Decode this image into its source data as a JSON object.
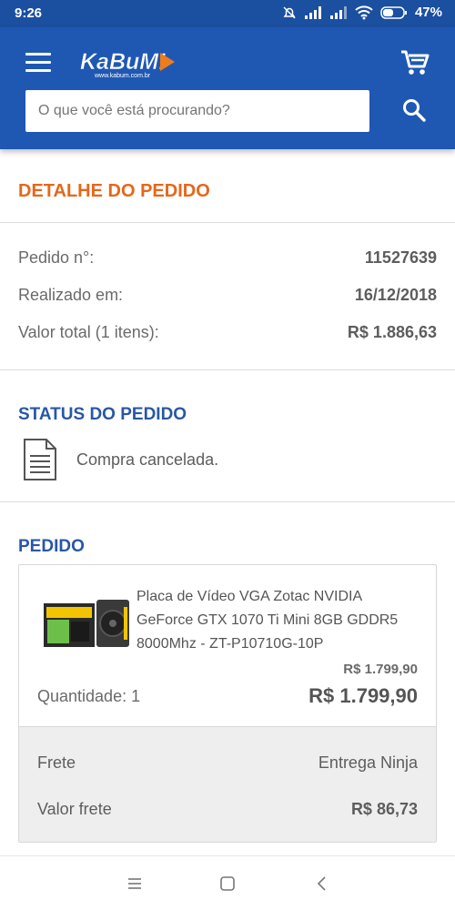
{
  "status_bar": {
    "time": "9:26",
    "battery": "47%"
  },
  "header": {
    "logo_text": "KaBuM!",
    "logo_sub": "www.kabum.com.br",
    "search": {
      "placeholder": "O que você está procurando?",
      "value": ""
    }
  },
  "order_detail": {
    "title": "DETALHE DO PEDIDO",
    "rows": [
      {
        "label": "Pedido n°:",
        "value": "11527639"
      },
      {
        "label": "Realizado em:",
        "value": "16/12/2018"
      },
      {
        "label": "Valor total (1 itens):",
        "value": "R$ 1.886,63"
      }
    ]
  },
  "order_status": {
    "title": "STATUS DO PEDIDO",
    "status": "Compra cancelada."
  },
  "order": {
    "title": "PEDIDO",
    "item": {
      "name": "Placa de Vídeo VGA Zotac NVIDIA GeForce GTX 1070 Ti Mini 8GB GDDR5 8000Mhz - ZT-P10710G-10P",
      "unit_price": "R$ 1.799,90",
      "quantity_label": "Quantidade: 1",
      "total_price": "R$ 1.799,90"
    },
    "shipping": [
      {
        "label": "Frete",
        "value": "Entrega Ninja"
      },
      {
        "label": "Valor frete",
        "value": "R$ 86,73"
      }
    ]
  },
  "colors": {
    "header_blue": "#1f58b3",
    "accent_orange": "#e5671b",
    "title_blue": "#2857a5"
  }
}
